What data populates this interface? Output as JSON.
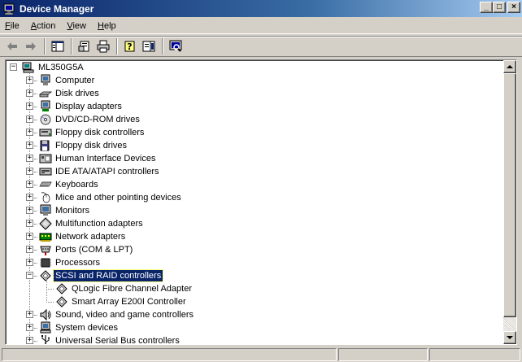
{
  "window": {
    "title": "Device Manager"
  },
  "title_controls": {
    "minimize": "_",
    "maximize": "□",
    "close": "×"
  },
  "menu": [
    "File",
    "Action",
    "View",
    "Help"
  ],
  "toolbar": [
    "back-arrow-icon",
    "forward-arrow-icon",
    "show-hide-tree-icon",
    "properties-icon",
    "print-icon",
    "help-icon",
    "show-hide-action-pane-icon",
    "scan-hardware-icon"
  ],
  "tree": {
    "root": "ML350G5A",
    "items": [
      {
        "label": "Computer",
        "icon": "computer-icon",
        "expanded": false
      },
      {
        "label": "Disk drives",
        "icon": "disk-drive-icon",
        "expanded": false
      },
      {
        "label": "Display adapters",
        "icon": "display-adapter-icon",
        "expanded": false
      },
      {
        "label": "DVD/CD-ROM drives",
        "icon": "cdrom-icon",
        "expanded": false
      },
      {
        "label": "Floppy disk controllers",
        "icon": "floppy-controller-icon",
        "expanded": false
      },
      {
        "label": "Floppy disk drives",
        "icon": "floppy-drive-icon",
        "expanded": false
      },
      {
        "label": "Human Interface Devices",
        "icon": "hid-icon",
        "expanded": false
      },
      {
        "label": "IDE ATA/ATAPI controllers",
        "icon": "ide-controller-icon",
        "expanded": false
      },
      {
        "label": "Keyboards",
        "icon": "keyboard-icon",
        "expanded": false
      },
      {
        "label": "Mice and other pointing devices",
        "icon": "mouse-icon",
        "expanded": false
      },
      {
        "label": "Monitors",
        "icon": "monitor-icon",
        "expanded": false
      },
      {
        "label": "Multifunction adapters",
        "icon": "multifunction-icon",
        "expanded": false
      },
      {
        "label": "Network adapters",
        "icon": "network-adapter-icon",
        "expanded": false
      },
      {
        "label": "Ports (COM & LPT)",
        "icon": "port-icon",
        "expanded": false
      },
      {
        "label": "Processors",
        "icon": "processor-icon",
        "expanded": false
      },
      {
        "label": "SCSI and RAID controllers",
        "icon": "scsi-icon",
        "expanded": true,
        "selected": true,
        "children": [
          {
            "label": "QLogic Fibre Channel Adapter",
            "icon": "scsi-icon"
          },
          {
            "label": "Smart Array E200I Controller",
            "icon": "scsi-icon"
          }
        ]
      },
      {
        "label": "Sound, video and game controllers",
        "icon": "sound-icon",
        "expanded": false
      },
      {
        "label": "System devices",
        "icon": "system-devices-icon",
        "expanded": false
      },
      {
        "label": "Universal Serial Bus controllers",
        "icon": "usb-icon",
        "expanded": false
      }
    ]
  },
  "colors": {
    "selection": "#0a246a",
    "title_start": "#0a246a",
    "title_end": "#a6caf0"
  }
}
